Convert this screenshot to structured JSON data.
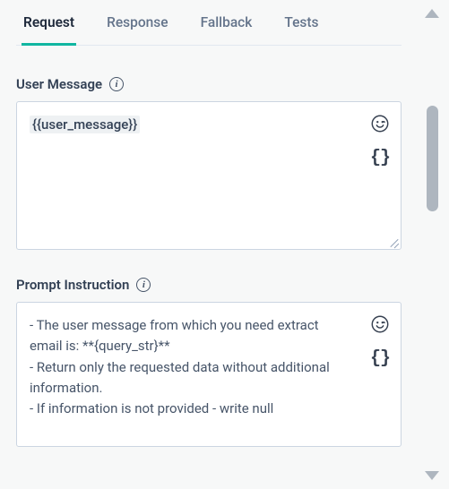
{
  "tabs": [
    {
      "label": "Request",
      "active": true
    },
    {
      "label": "Response",
      "active": false
    },
    {
      "label": "Fallback",
      "active": false
    },
    {
      "label": "Tests",
      "active": false
    }
  ],
  "sections": {
    "userMessage": {
      "label": "User Message",
      "content_token": "{{user_message}}"
    },
    "promptInstruction": {
      "label": "Prompt Instruction",
      "content": "- The user message from which you need extract email is: **{query_str}**\n- Return only the requested data without additional information.\n- If information is not provided - write null"
    }
  },
  "icons": {
    "info": "i",
    "braces": "{}"
  }
}
